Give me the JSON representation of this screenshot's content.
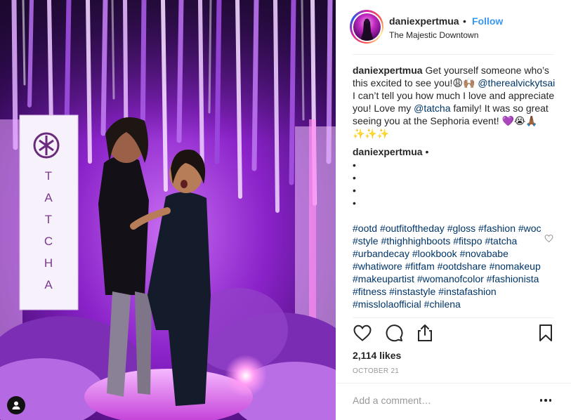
{
  "post": {
    "username": "daniexpertmua",
    "separator": "•",
    "follow_label": "Follow",
    "location": "The Majestic Downtown"
  },
  "photo": {
    "brand_text": "TATCHA",
    "brand_letters": [
      "T",
      "A",
      "T",
      "C",
      "H",
      "A"
    ]
  },
  "caption": {
    "username": "daniexpertmua",
    "text_1": " Get yourself someone who’s this excited to see you!😩🙌🏽",
    "mention_1": "@therealvickytsai",
    "text_2": " I can’t tell you how much I love and appreciate you! Love my ",
    "mention_2": "@tatcha",
    "text_3": " family! It was so great seeing you at the Sephoria event! 💜😭🙏🏾✨✨✨"
  },
  "second_comment": {
    "username": "daniexpertmua",
    "separator": "•",
    "bullets": [
      "•",
      "•",
      "•",
      "•"
    ],
    "hashtags": [
      "#ootd",
      "#outfitoftheday",
      "#gloss",
      "#fashion",
      "#woc",
      "#style",
      "#thighhighboots",
      "#fitspo",
      "#tatcha",
      "#urbandecay",
      "#lookbook",
      "#novababe",
      "#whatiwore",
      "#fitfam",
      "#ootdshare",
      "#nomakeup",
      "#makeupartist",
      "#womanofcolor",
      "#fashionista",
      "#fitness",
      "#instastyle",
      "#instafashion",
      "#misslolaofficial",
      "#chilena"
    ]
  },
  "stats": {
    "likes": "2,114 likes",
    "date": "OCTOBER 21"
  },
  "comment_box": {
    "placeholder": "Add a comment…"
  },
  "icons": {
    "like": "heart-icon",
    "comment": "comment-icon",
    "share": "share-icon",
    "save": "bookmark-icon",
    "more": "more-options-icon",
    "comment_like": "small-heart-icon",
    "user_tag": "user-tag-icon"
  },
  "colors": {
    "link": "#3897f0",
    "hashtag": "#003569",
    "muted": "#999999",
    "text": "#262626"
  }
}
